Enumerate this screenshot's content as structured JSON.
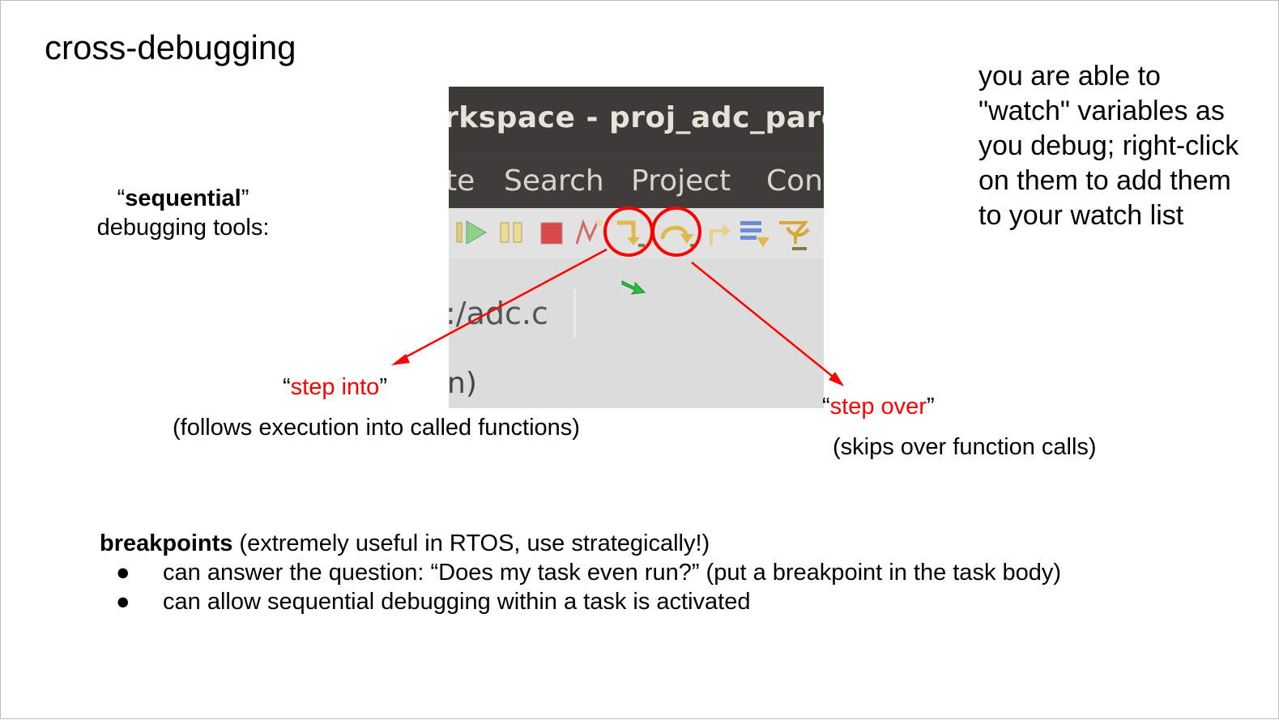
{
  "slide": {
    "title": "cross-debugging",
    "sequential": {
      "open_quote": "“",
      "keyword": "sequential",
      "close_quote": "”",
      "line2": "debugging tools:"
    },
    "watch_text": "you are able to \"watch\" variables as you debug; right-click on them to add them to your watch list",
    "screenshot": {
      "window_title": "rkspace - proj_adc_pare",
      "menu": [
        "te",
        "Search",
        "Project",
        "Con"
      ],
      "file_tab": ":/adc.c",
      "function_text": "n)",
      "toolbar_icons": [
        "resume-icon",
        "suspend-icon",
        "terminate-icon",
        "disconnect-icon",
        "step-into-icon",
        "step-over-icon",
        "step-return-icon",
        "drop-to-frame-icon",
        "use-step-filters-icon"
      ],
      "colors": {
        "title_bar": "#3d3a37",
        "menu_bar": "#3e3d3a",
        "toolbar": "#e2e2e2",
        "highlight": "#ff0000"
      }
    },
    "step_into": {
      "open_quote": "“",
      "label": "step into",
      "close_quote": "”",
      "description": "(follows execution into called functions)"
    },
    "step_over": {
      "open_quote": "“",
      "label": "step over",
      "close_quote": "”",
      "description": "(skips over function calls)"
    },
    "breakpoints": {
      "keyword": "breakpoints",
      "rest": " (extremely useful in RTOS, use strategically!)",
      "bullet_glyph": "●",
      "items": [
        "can answer the question: “Does my task even run?” (put a breakpoint in the task body)",
        "can allow sequential debugging within a task is activated"
      ]
    }
  }
}
